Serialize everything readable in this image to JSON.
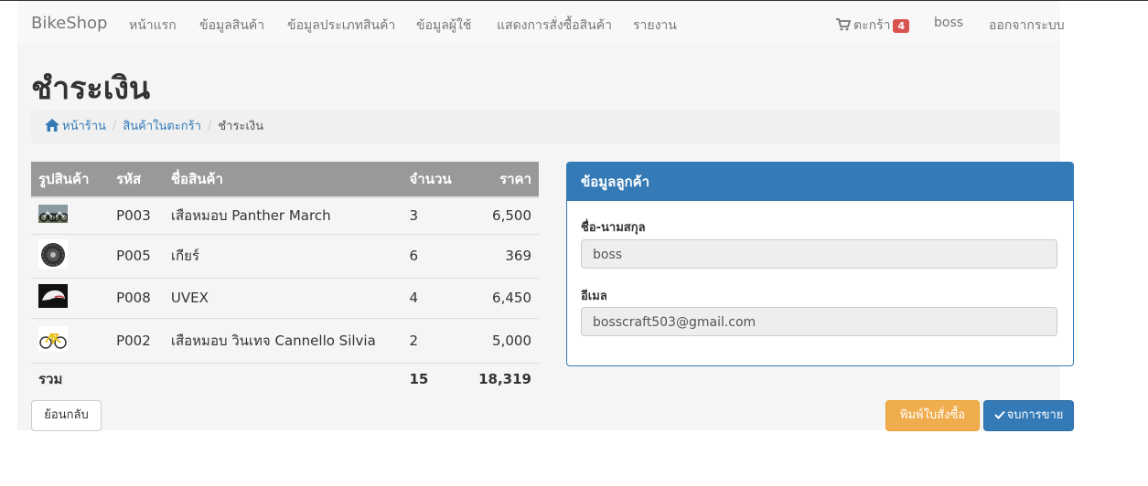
{
  "navbar": {
    "brand": "BikeShop",
    "items": [
      "หน้าแรก",
      "ข้อมูลสินค้า",
      "ข้อมูลประเภทสินค้า",
      "ข้อมูลผู้ใช้",
      "แสดงการสั่งซื้อสินค้า",
      "รายงาน"
    ],
    "cart_label": "ตะกร้า",
    "cart_count": "4",
    "user": "boss",
    "logout": "ออกจากระบบ"
  },
  "page_title": "ชำระเงิน",
  "breadcrumb": {
    "home": "หน้าร้าน",
    "cart": "สินค้าในตะกร้า",
    "current": "ชำระเงิน"
  },
  "table": {
    "headers": {
      "image": "รูปสินค้า",
      "code": "รหัส",
      "name": "ชื่อสินค้า",
      "qty": "จำนวน",
      "price": "ราคา"
    },
    "rows": [
      {
        "image": "bike-pair-image",
        "code": "P003",
        "name": "เสือหมอบ Panther March",
        "qty": "3",
        "price": "6,500"
      },
      {
        "image": "gear-cassette-image",
        "code": "P005",
        "name": "เกียร์",
        "qty": "6",
        "price": "369"
      },
      {
        "image": "uvex-helmet-image",
        "code": "P008",
        "name": "UVEX",
        "qty": "4",
        "price": "6,450"
      },
      {
        "image": "yellow-bike-image",
        "code": "P002",
        "name": "เสือหมอบ วินเทจ Cannello Silvia",
        "qty": "2",
        "price": "5,000"
      }
    ],
    "total_label": "รวม",
    "total_qty": "15",
    "total_price": "18,319"
  },
  "customer_panel": {
    "title": "ข้อมูลลูกค้า",
    "name_label": "ชื่อ-นามสกุล",
    "name_value": "boss",
    "email_label": "อีเมล",
    "email_value": "bosscraft503@gmail.com"
  },
  "buttons": {
    "back": "ย้อนกลับ",
    "print": "พิมพ์ใบสั่งซื้อ",
    "finish": "จบการขาย"
  },
  "colors": {
    "primary": "#337ab7",
    "warning": "#f0ad4e",
    "badge": "#d9534f",
    "table_header": "#999999"
  }
}
